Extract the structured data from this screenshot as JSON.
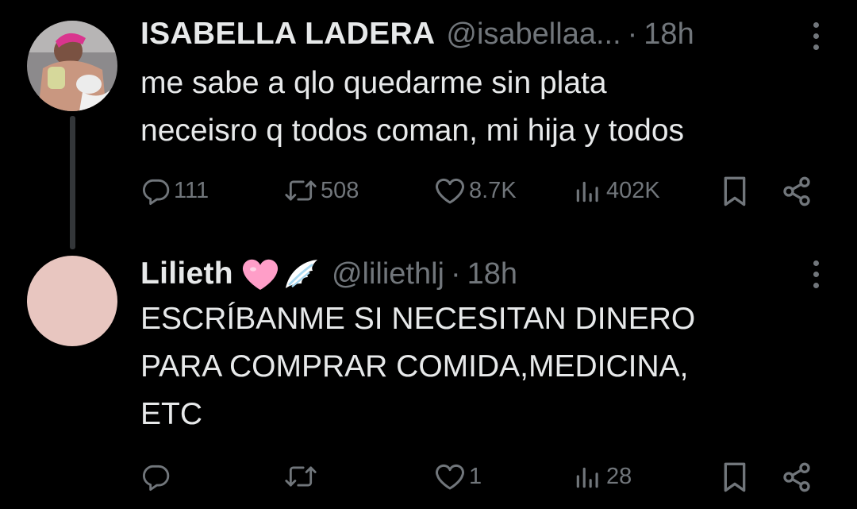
{
  "tweets": [
    {
      "name": "ISABELLA LADERA",
      "handle": "@isabellaa...",
      "separator": "·",
      "time": "18h",
      "text_lines": [
        "me sabe a qlo quedarme sin plata",
        "neceisro q todos coman, mi hija y todos"
      ],
      "stats": {
        "replies": "111",
        "reposts": "508",
        "likes": "8.7K",
        "views": "402K"
      }
    },
    {
      "name": "Lilieth",
      "emojis": [
        "pink-heart-emoji",
        "wing-emoji"
      ],
      "handle": "@liliethlj",
      "separator": "·",
      "time": "18h",
      "text_lines": [
        "ESCRÍBANME SI NECESITAN DINERO",
        "PARA COMPRAR COMIDA,MEDICINA,",
        "ETC"
      ],
      "stats": {
        "replies": "",
        "reposts": "",
        "likes": "1",
        "views": "28"
      }
    }
  ],
  "colors": {
    "background": "#000000",
    "text": "#e7e9ea",
    "muted": "#71767b",
    "thread_line": "#333639",
    "avatar_placeholder": "#e8c6c0"
  },
  "icons": [
    "reply-icon",
    "repost-icon",
    "like-icon",
    "views-icon",
    "bookmark-icon",
    "share-icon",
    "more-icon"
  ]
}
